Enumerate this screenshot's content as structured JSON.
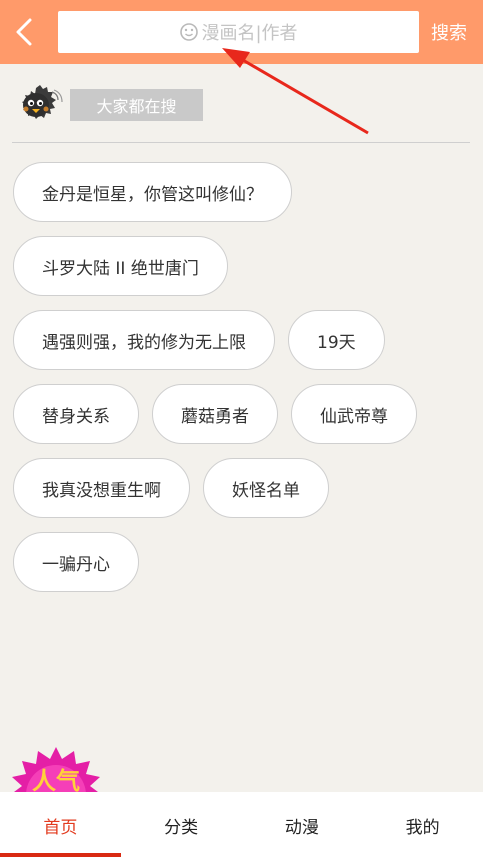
{
  "header": {
    "back_icon": "chevron-left-icon",
    "search_placeholder": "漫画名|作者",
    "search_label": "搜索",
    "bg_color": "#ff9a6a"
  },
  "hot": {
    "label": "大家都在搜",
    "tags": [
      [
        "金丹是恒星，你管这叫修仙？"
      ],
      [
        "斗罗大陆 II 绝世唐门"
      ],
      [
        "遇强则强，我的修为无上限",
        "19天"
      ],
      [
        "替身关系",
        "蘑菇勇者",
        "仙武帝尊"
      ],
      [
        "我真没想重生啊",
        "妖怪名单"
      ],
      [
        "一骗丹心"
      ]
    ]
  },
  "badge": {
    "text": "人气"
  },
  "bottom_nav": {
    "tabs": [
      "首页",
      "分类",
      "动漫",
      "我的"
    ],
    "active": 0,
    "accent": "#e23a1e"
  }
}
